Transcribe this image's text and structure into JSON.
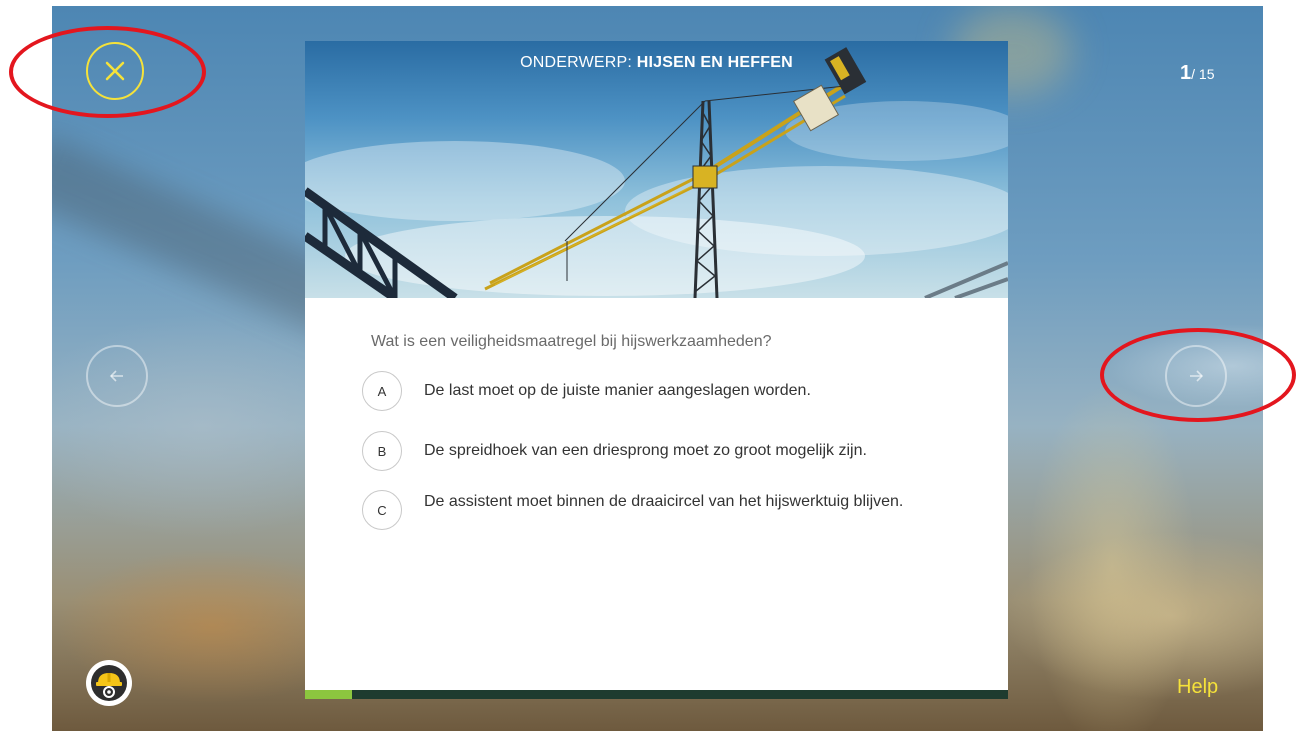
{
  "topic": {
    "prefix": "ONDERWERP:",
    "value": "HIJSEN EN HEFFEN"
  },
  "counter": {
    "current": "1",
    "total": "/ 15"
  },
  "question": "Wat is een veiligheidsmaatregel bij hijswerkzaamheden?",
  "options": [
    {
      "letter": "A",
      "text": "De last moet op de juiste manier aangeslagen worden."
    },
    {
      "letter": "B",
      "text": "De spreidhoek van een driesprong moet zo groot mogelijk zijn."
    },
    {
      "letter": "C",
      "text": "De assistent moet binnen de draaicircel van het hijswerktuig blijven."
    }
  ],
  "help_label": "Help",
  "progress": {
    "current": 1,
    "total": 15,
    "fraction": 0.0667
  },
  "icons": {
    "close": "close-icon",
    "prev": "arrow-left-icon",
    "next": "arrow-right-icon",
    "settings": "hardhat-gear-icon"
  },
  "colors": {
    "accent_yellow": "#f5e23a",
    "progress_fill": "#8cc63f",
    "progress_track": "#1e3b2f",
    "annotation_red": "#e3161e"
  }
}
